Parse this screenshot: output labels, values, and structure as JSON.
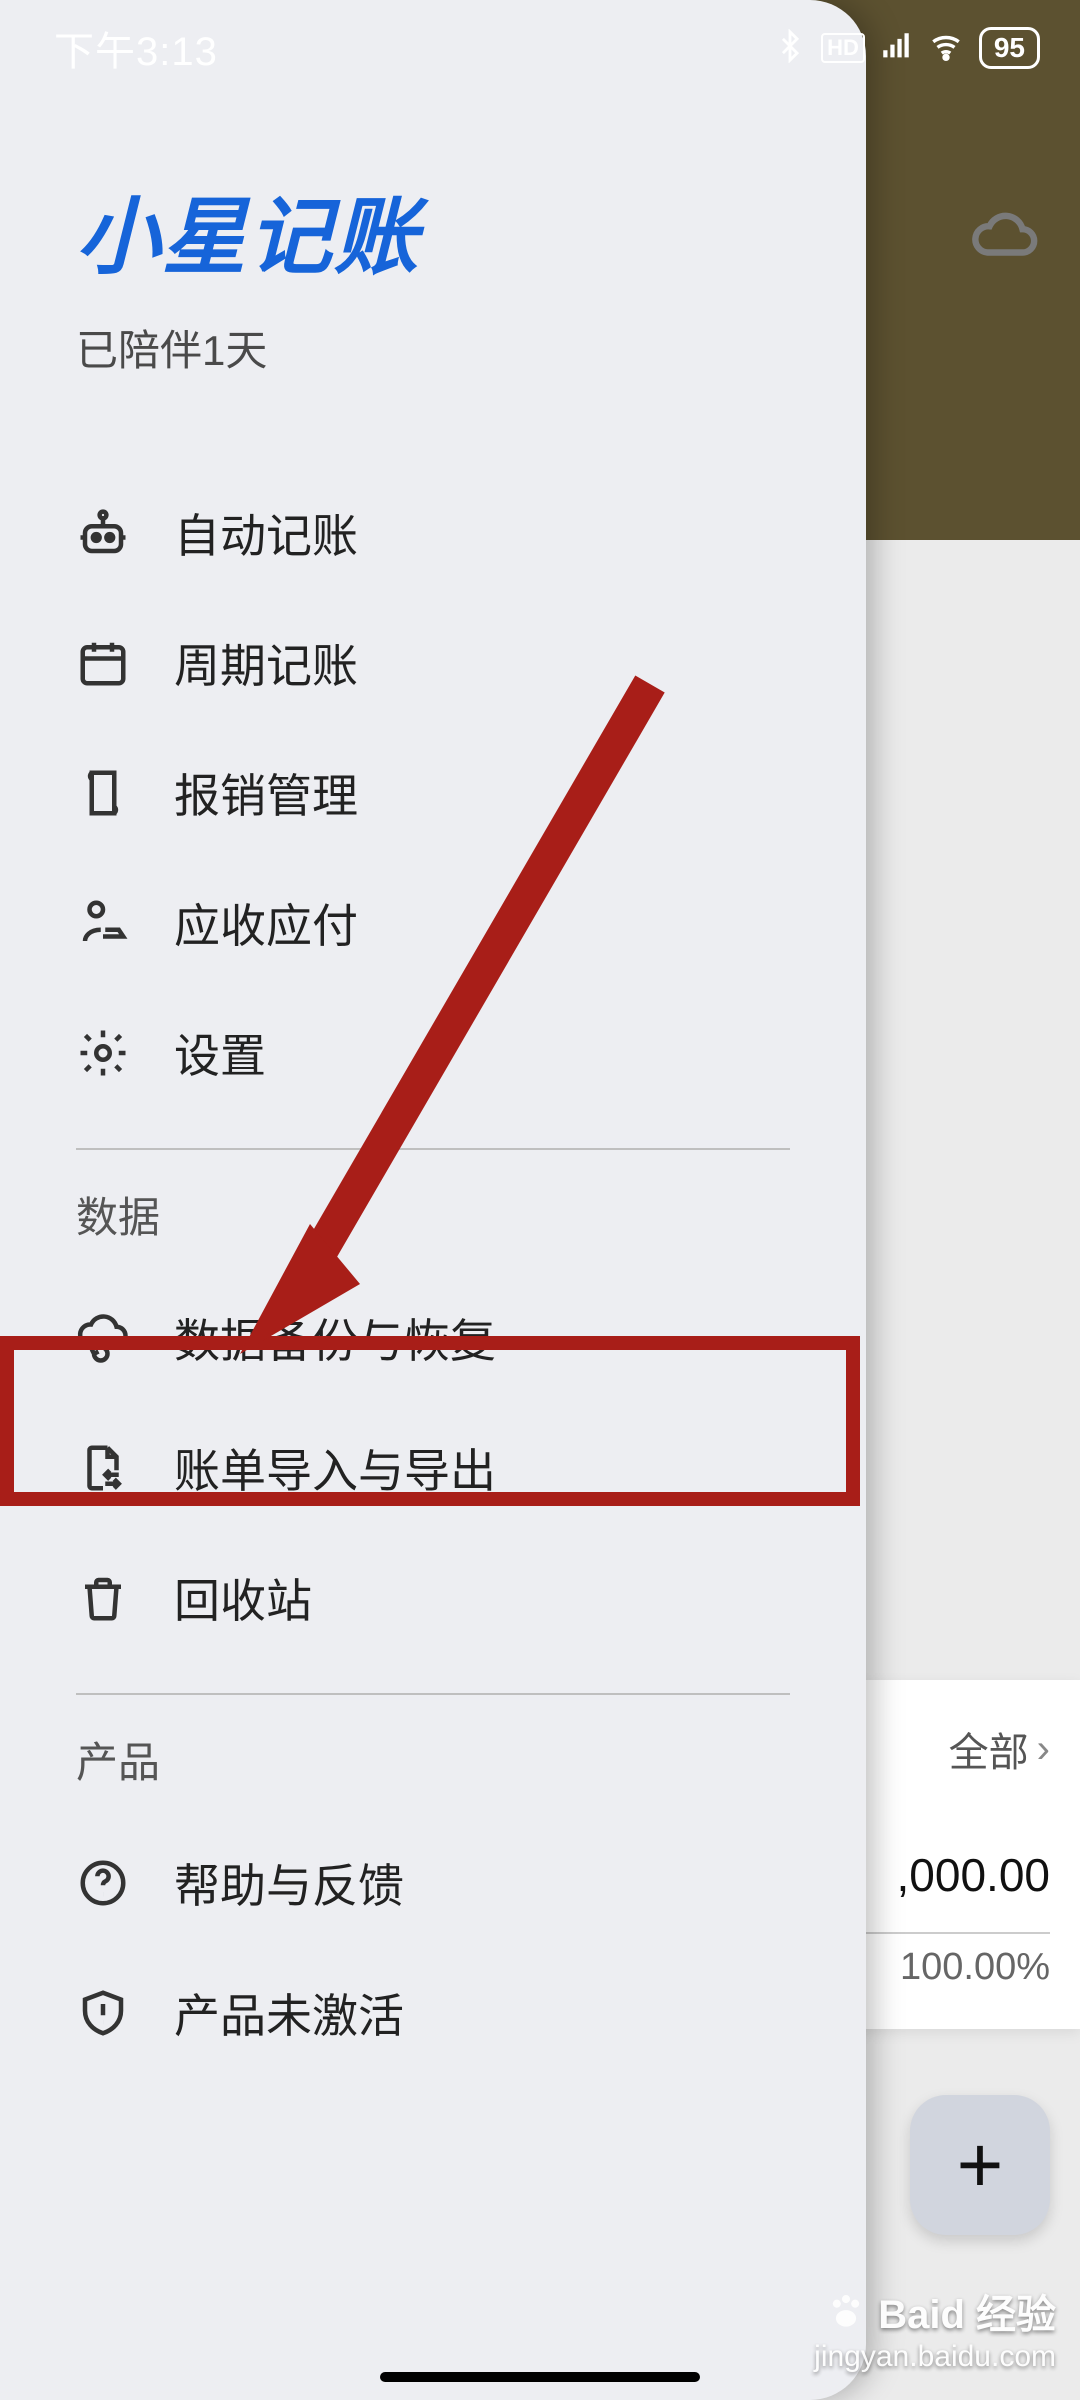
{
  "statusbar": {
    "time": "下午3:13",
    "battery": "95"
  },
  "drawer": {
    "app_title": "小星记账",
    "subtitle": "已陪伴1天",
    "menu_main": [
      {
        "id": "auto",
        "label": "自动记账",
        "icon": "robot"
      },
      {
        "id": "cycle",
        "label": "周期记账",
        "icon": "calendar"
      },
      {
        "id": "expense",
        "label": "报销管理",
        "icon": "receipt"
      },
      {
        "id": "payable",
        "label": "应收应付",
        "icon": "hand-coin"
      },
      {
        "id": "settings",
        "label": "设置",
        "icon": "gear"
      }
    ],
    "section_data_label": "数据",
    "menu_data": [
      {
        "id": "backup",
        "label": "数据备份与恢复",
        "icon": "cloud-sync"
      },
      {
        "id": "import",
        "label": "账单导入与导出",
        "icon": "file-swap"
      },
      {
        "id": "trash",
        "label": "回收站",
        "icon": "trash"
      }
    ],
    "section_product_label": "产品",
    "menu_product": [
      {
        "id": "help",
        "label": "帮助与反馈",
        "icon": "help"
      },
      {
        "id": "activate",
        "label": "产品未激活",
        "icon": "shield-alert"
      }
    ]
  },
  "right_card": {
    "filter": "全部",
    "amount": ",000.00",
    "percent": "100.00%"
  },
  "watermark": {
    "brand": "Baid 经验",
    "url": "jingyan.baidu.com"
  }
}
